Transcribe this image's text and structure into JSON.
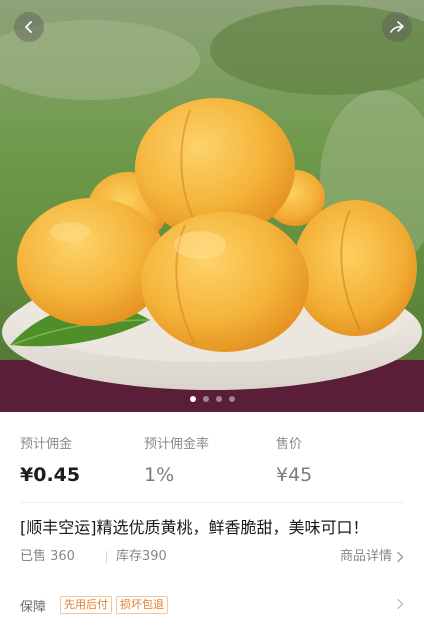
{
  "hero": {
    "carousel": {
      "total": 4,
      "active": 1
    },
    "icons": {
      "back": "chevron-left-icon",
      "share": "share-arrow-icon"
    }
  },
  "stats": {
    "commission": {
      "label": "预计佣金",
      "value": "¥0.45"
    },
    "commission_rate": {
      "label": "预计佣金率",
      "value": "1%"
    },
    "price": {
      "label": "售价",
      "value": "¥45"
    }
  },
  "product": {
    "title": "[顺丰空运]精选优质黄桃，鲜香脆甜，美味可口！",
    "sold": "已售 360",
    "stock": "库存390",
    "detail_link": "商品详情"
  },
  "guarantee": {
    "label": "保障",
    "tags": [
      "先用后付",
      "损坏包退"
    ]
  },
  "colors": {
    "tag": "#e27d28",
    "tag_border": "#f3c79e",
    "peach": "#f4b43a"
  }
}
